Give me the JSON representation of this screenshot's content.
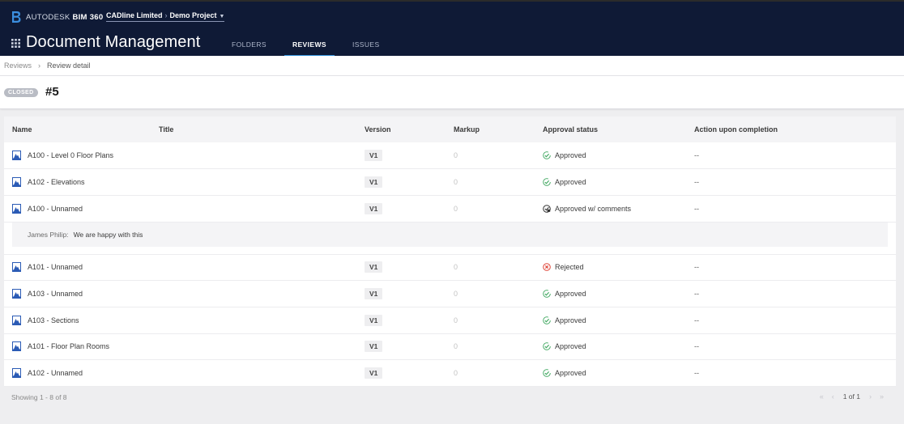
{
  "topbar": {
    "brand_light": "AUTODESK",
    "brand_bold": "BIM 360",
    "account": "CADline Limited",
    "project": "Demo Project",
    "page_title": "Document Management",
    "tabs": [
      {
        "label": "FOLDERS",
        "active": false
      },
      {
        "label": "REVIEWS",
        "active": true
      },
      {
        "label": "ISSUES",
        "active": false
      }
    ]
  },
  "breadcrumb": {
    "parent": "Reviews",
    "current": "Review detail"
  },
  "review": {
    "status": "CLOSED",
    "number": "#5"
  },
  "table": {
    "columns": {
      "name": "Name",
      "title": "Title",
      "version": "Version",
      "markup": "Markup",
      "approval": "Approval status",
      "action": "Action upon completion"
    },
    "rows": [
      {
        "name": "A100 - Level 0 Floor Plans",
        "title": "",
        "version": "V1",
        "markup": "0",
        "status": "Approved",
        "status_type": "approved",
        "action": "--"
      },
      {
        "name": "A102 - Elevations",
        "title": "",
        "version": "V1",
        "markup": "0",
        "status": "Approved",
        "status_type": "approved",
        "action": "--"
      },
      {
        "name": "A100 - Unnamed",
        "title": "",
        "version": "V1",
        "markup": "0",
        "status": "Approved w/ comments",
        "status_type": "approved-comments",
        "action": "--"
      },
      {
        "name": "A101 - Unnamed",
        "title": "",
        "version": "V1",
        "markup": "0",
        "status": "Rejected",
        "status_type": "rejected",
        "action": "--"
      },
      {
        "name": "A103 - Unnamed",
        "title": "",
        "version": "V1",
        "markup": "0",
        "status": "Approved",
        "status_type": "approved",
        "action": "--"
      },
      {
        "name": "A103 - Sections",
        "title": "",
        "version": "V1",
        "markup": "0",
        "status": "Approved",
        "status_type": "approved",
        "action": "--"
      },
      {
        "name": "A101 - Floor Plan Rooms",
        "title": "",
        "version": "V1",
        "markup": "0",
        "status": "Approved",
        "status_type": "approved",
        "action": "--"
      },
      {
        "name": "A102 - Unnamed",
        "title": "",
        "version": "V1",
        "markup": "0",
        "status": "Approved",
        "status_type": "approved",
        "action": "--"
      }
    ],
    "comment": {
      "author": "James Philip:",
      "text": "We are happy with this"
    }
  },
  "footer": {
    "showing": "Showing 1 - 8 of 8",
    "page": "1 of 1"
  },
  "icons": {
    "brand": "bim360-logo-icon",
    "apps": "apps-grid-icon",
    "file": "sheet-file-icon",
    "approved": "check-circle-icon",
    "approved_comments": "check-comment-icon",
    "rejected": "x-circle-icon"
  },
  "colors": {
    "topbar": "#0f1a36",
    "accent": "#2f8fd9",
    "approved": "#3aa55b",
    "rejected": "#e0463a"
  }
}
